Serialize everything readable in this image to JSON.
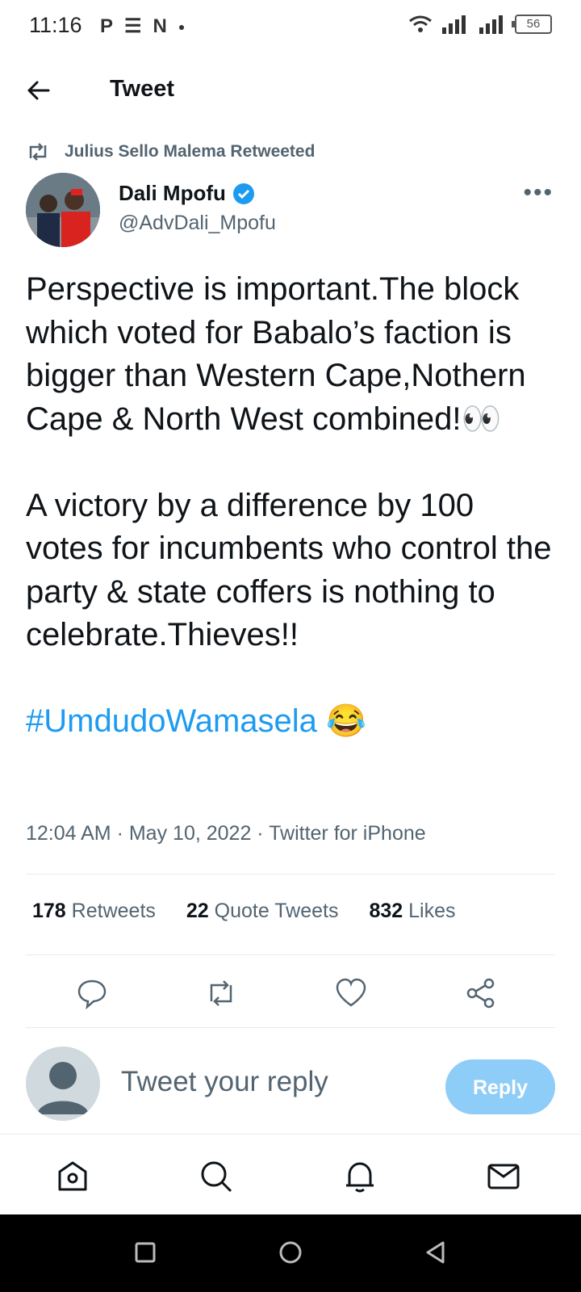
{
  "status_bar": {
    "time": "11:16",
    "battery": "56",
    "notif_icons": [
      "p-icon",
      "news-icon",
      "n-icon"
    ]
  },
  "header": {
    "title": "Tweet"
  },
  "retweet_context": {
    "text": "Julius Sello Malema Retweeted"
  },
  "author": {
    "name": "Dali Mpofu",
    "handle": "@AdvDali_Mpofu"
  },
  "tweet": {
    "paragraph1": "Perspective is important.The block which voted for Babalo’s faction is bigger than Western Cape,Nothern Cape & North West combined!👀",
    "paragraph2": "A victory by a difference by 100 votes for incumbents who control the party & state coffers is nothing to celebrate.Thieves!!",
    "hashtag": "#UmdudoWamasela",
    "emoji": "😂"
  },
  "meta": {
    "time": "12:04 AM",
    "date": "May 10, 2022",
    "source": "Twitter for iPhone"
  },
  "stats": {
    "retweets_count": "178",
    "retweets_label": "Retweets",
    "quotes_count": "22",
    "quotes_label": "Quote Tweets",
    "likes_count": "832",
    "likes_label": "Likes"
  },
  "reply": {
    "placeholder": "Tweet your reply",
    "button_label": "Reply"
  },
  "colors": {
    "accent": "#1d9bf0",
    "reply_button": "#8ecdf8",
    "secondary_text": "#536471"
  }
}
